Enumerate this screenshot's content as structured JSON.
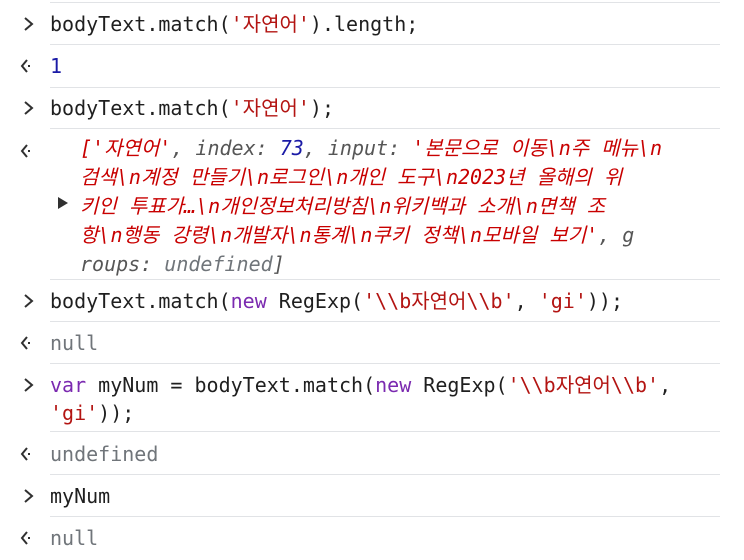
{
  "entries": [
    {
      "type": "input",
      "parts": [
        {
          "t": "bodyText.match(",
          "c": ""
        },
        {
          "t": "'자연어'",
          "c": "str"
        },
        {
          "t": ").length;",
          "c": ""
        }
      ]
    },
    {
      "type": "output",
      "value": "1",
      "kind": "number"
    },
    {
      "type": "input",
      "parts": [
        {
          "t": "bodyText.match(",
          "c": ""
        },
        {
          "t": "'자연어'",
          "c": "str"
        },
        {
          "t": ");",
          "c": ""
        }
      ]
    },
    {
      "type": "array_output",
      "lines": [
        [
          {
            "t": "['자연어'",
            "c": "s"
          },
          {
            "t": ", index: ",
            "c": "k"
          },
          {
            "t": "73",
            "c": "n"
          },
          {
            "t": ", input: ",
            "c": "k"
          },
          {
            "t": "'본문으로 이동\\n주 메뉴\\n",
            "c": "s"
          }
        ],
        [
          {
            "t": "검색\\n계정 만들기\\n로그인\\n개인 도구\\n2023년 올해의 위",
            "c": "s"
          }
        ],
        [
          {
            "t": "키인 투표가…\\n개인정보처리방침\\n위키백과 소개\\n면책 조",
            "c": "s"
          }
        ],
        [
          {
            "t": "항\\n행동 강령\\n개발자\\n통계\\n쿠키 정책\\n모바일 보기'",
            "c": "s"
          },
          {
            "t": ", g",
            "c": "k"
          }
        ],
        [
          {
            "t": "roups: ",
            "c": "k"
          },
          {
            "t": "undefined",
            "c": "u"
          },
          {
            "t": "]",
            "c": "k"
          }
        ]
      ]
    },
    {
      "type": "input",
      "parts": [
        {
          "t": "bodyText.match(",
          "c": ""
        },
        {
          "t": "new",
          "c": "kw"
        },
        {
          "t": " RegExp(",
          "c": ""
        },
        {
          "t": "'\\\\b자연어\\\\b'",
          "c": "str"
        },
        {
          "t": ", ",
          "c": ""
        },
        {
          "t": "'gi'",
          "c": "str"
        },
        {
          "t": "));",
          "c": ""
        }
      ]
    },
    {
      "type": "output",
      "value": "null",
      "kind": "muted"
    },
    {
      "type": "input",
      "lines": [
        [
          {
            "t": "var",
            "c": "kw"
          },
          {
            "t": " myNum = bodyText.match(",
            "c": ""
          },
          {
            "t": "new",
            "c": "kw"
          },
          {
            "t": " RegExp(",
            "c": ""
          },
          {
            "t": "'\\\\b자연어\\\\b'",
            "c": "str"
          },
          {
            "t": ",",
            "c": ""
          }
        ],
        [
          {
            "t": "'gi'",
            "c": "str"
          },
          {
            "t": "));",
            "c": ""
          }
        ]
      ]
    },
    {
      "type": "output",
      "value": "undefined",
      "kind": "muted"
    },
    {
      "type": "input",
      "parts": [
        {
          "t": "myNum",
          "c": ""
        }
      ]
    },
    {
      "type": "output",
      "value": "null",
      "kind": "muted"
    }
  ],
  "icons": {
    "input": "chevron-right-icon",
    "output": "return-arrow-icon",
    "expand": "expand-triangle-icon"
  }
}
